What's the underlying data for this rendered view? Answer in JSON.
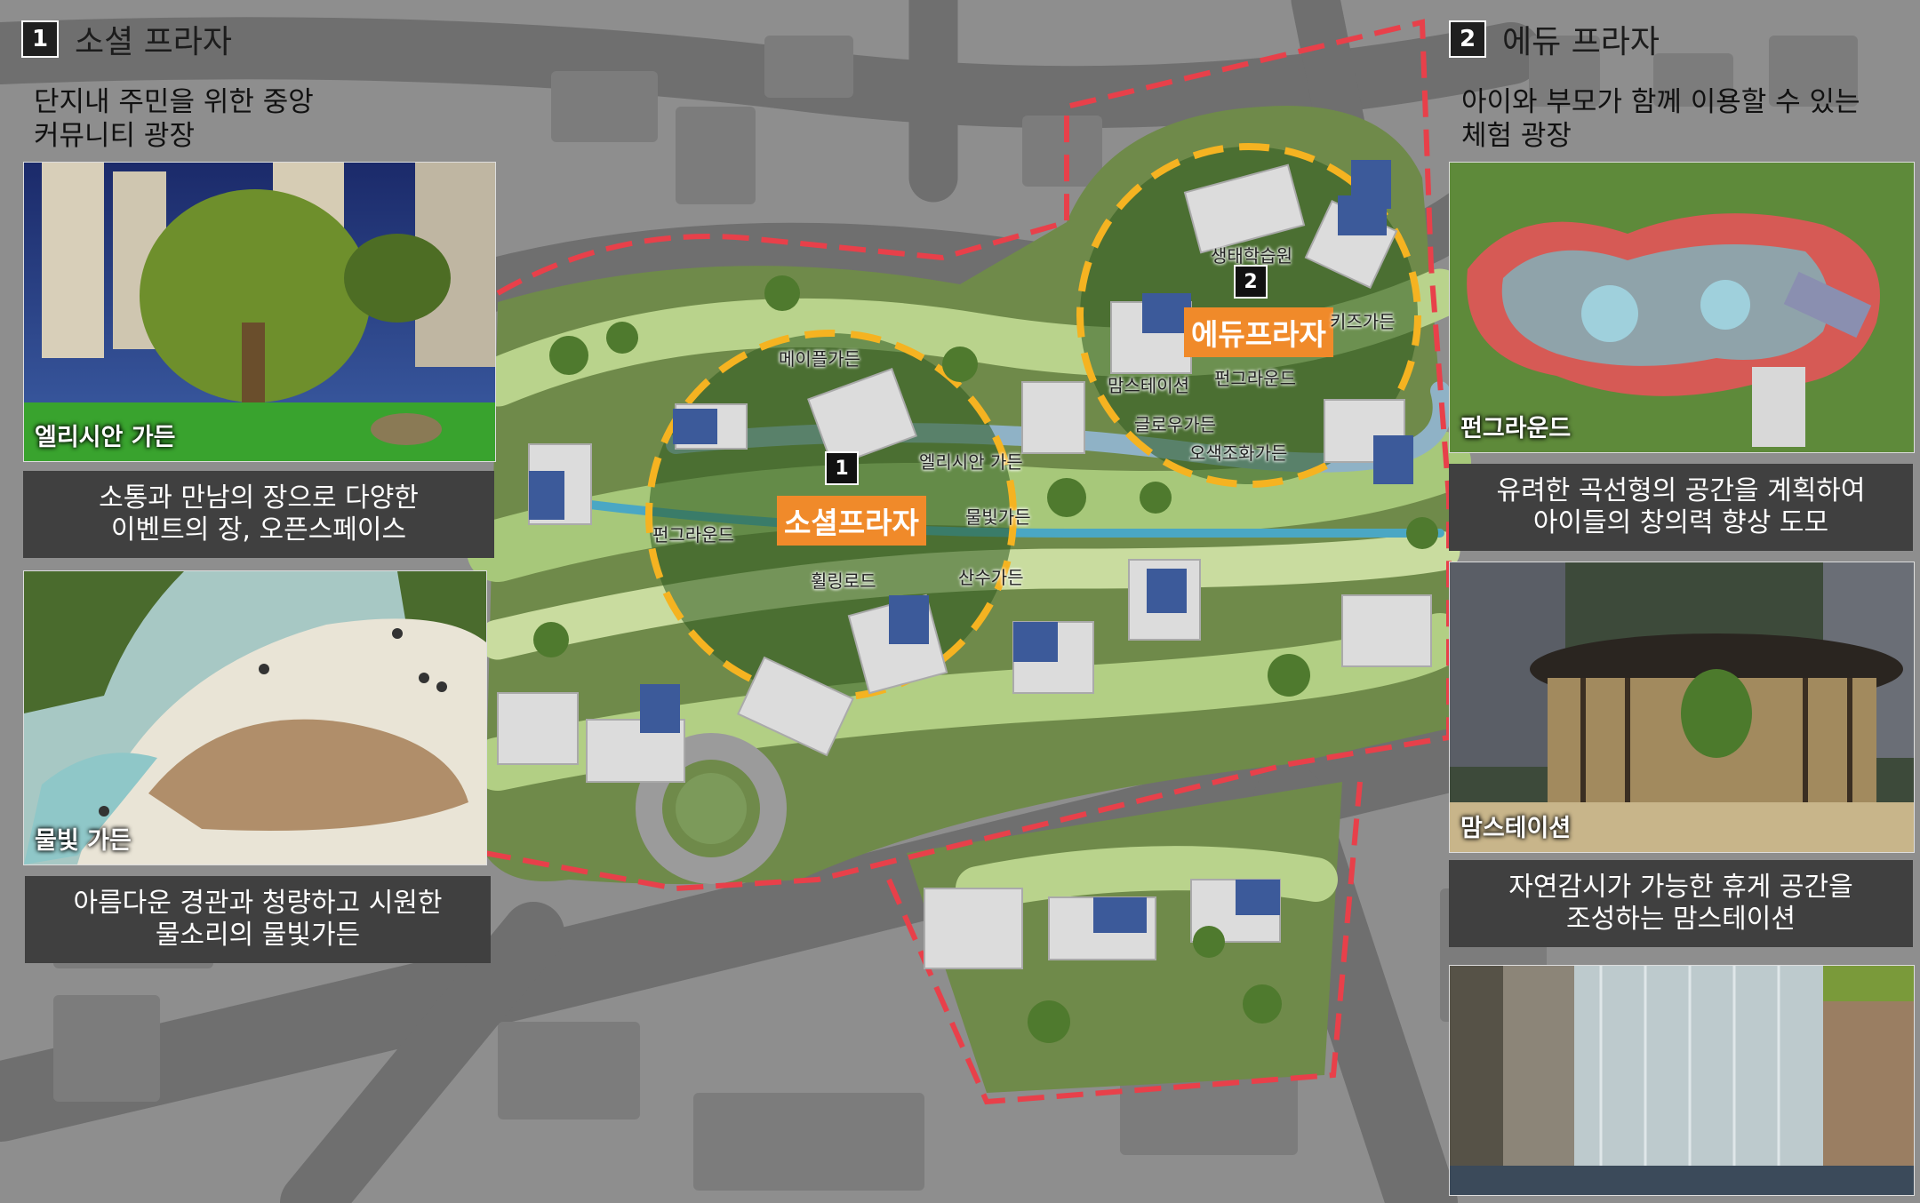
{
  "left": {
    "number": "1",
    "title": "소셜 프라자",
    "subtitle": "단지내 주민을 위한 중앙\n커뮤니티 광장",
    "photo1_label": "엘리시안 가든",
    "caption1": "소통과 만남의 장으로 다양한\n이벤트의 장, 오픈스페이스",
    "photo2_label": "물빛 가든",
    "caption2": "아름다운 경관과 청량하고 시원한\n물소리의 물빛가든"
  },
  "right": {
    "number": "2",
    "title": "에듀 프라자",
    "subtitle": "아이와 부모가 함께 이용할 수 있는\n체험 광장",
    "photo1_label": "펀그라운드",
    "caption1": "유려한 곡선형의 공간을 계획하여\n아이들의 창의력 향상 도모",
    "photo2_label": "맘스테이션",
    "caption2": "자연감시가 가능한 휴게 공간을\n조성하는 맘스테이션"
  },
  "map": {
    "social_plaza_tag": "소셜프라자",
    "edu_plaza_tag": "에듀프라자",
    "marker1": "1",
    "marker2": "2",
    "labels": {
      "maple": "메이플가든",
      "elysian": "엘리시안 가든",
      "fun1": "펀그라운드",
      "water": "물빛가든",
      "wellness": "휠링로드",
      "forest": "산수가든",
      "eco": "생태학습원",
      "kids": "키즈가든",
      "moms": "맘스테이션",
      "fun2": "펀그라운드",
      "glow": "글로우가든",
      "five": "오색조화가든"
    }
  },
  "colors": {
    "accent_orange": "#f08a2a",
    "plaza_ring": "#f5b321",
    "boundary": "#e8404a",
    "caption_bg": "#404040"
  }
}
